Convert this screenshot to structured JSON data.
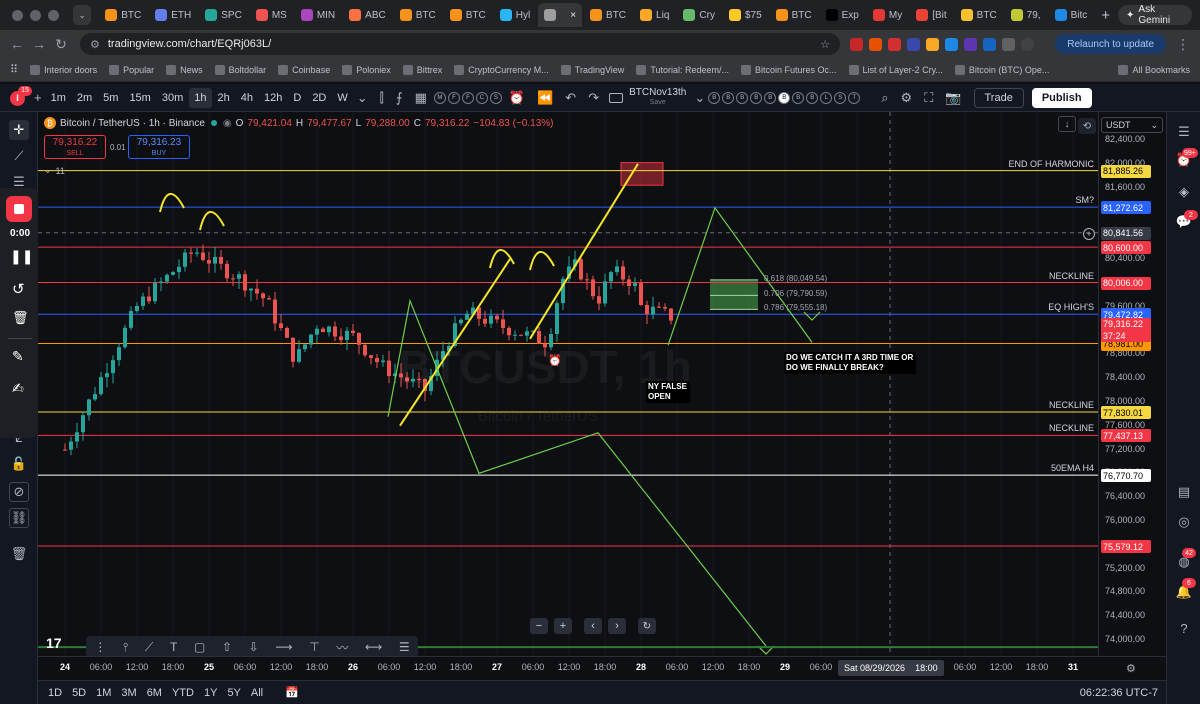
{
  "browser": {
    "tabs": [
      {
        "label": "BTC",
        "color": "#f7931a"
      },
      {
        "label": "ETH",
        "color": "#627eea"
      },
      {
        "label": "SPC",
        "color": "#26a69a"
      },
      {
        "label": "MS",
        "color": "#ef5350"
      },
      {
        "label": "MIN",
        "color": "#ab47bc"
      },
      {
        "label": "ABC",
        "color": "#ff7043"
      },
      {
        "label": "BTC",
        "color": "#f7931a"
      },
      {
        "label": "BTC",
        "color": "#f7931a"
      },
      {
        "label": "Hyl",
        "color": "#29b6f6"
      },
      {
        "label": "",
        "color": "#9e9e9e"
      },
      {
        "label": "BTC",
        "color": "#f7931a"
      },
      {
        "label": "Liq",
        "color": "#ffa726"
      },
      {
        "label": "Cry",
        "color": "#66bb6a"
      },
      {
        "label": "$75",
        "color": "#ffca28"
      },
      {
        "label": "BTC",
        "color": "#f7931a"
      },
      {
        "label": "Exp",
        "color": "#000000"
      },
      {
        "label": "My",
        "color": "#e53935"
      },
      {
        "label": "[Bit",
        "color": "#ea4335"
      },
      {
        "label": "BTC",
        "color": "#fbc02d"
      },
      {
        "label": "79,",
        "color": "#c0ca33"
      },
      {
        "label": "Bitc",
        "color": "#1e88e5"
      }
    ],
    "ask_gemini": "Ask Gemini",
    "url": "tradingview.com/chart/EQRj063L/",
    "relaunch": "Relaunch to update",
    "bookmarks": [
      "Interior doors",
      "Popular",
      "News",
      "Boltdollar",
      "Coinbase",
      "Poloniex",
      "Bittrex",
      "CryptoCurrency M...",
      "TradingView",
      "Tutorial: Redeem/...",
      "Bitcoin Futures Oc...",
      "List of Layer-2 Cry...",
      "Bitcoin (BTC) Ope..."
    ],
    "all_bookmarks": "All Bookmarks"
  },
  "toolbar": {
    "alert_count": "15",
    "timeframes": [
      "1m",
      "2m",
      "5m",
      "15m",
      "30m",
      "1h",
      "2h",
      "4h",
      "12h",
      "D",
      "2D",
      "W"
    ],
    "active_timeframe": "1h",
    "indicator_letters": [
      "M",
      "F",
      "F",
      "C",
      "S"
    ],
    "layout_name": "BTCNov13th",
    "layout_sub": "Save",
    "symbol_letters": [
      "B",
      "B",
      "B",
      "B",
      "B",
      "B",
      "B",
      "B",
      "L",
      "S",
      "T"
    ],
    "trade": "Trade",
    "publish": "Publish"
  },
  "legend": {
    "symbol": "Bitcoin / TetherUS · 1h · Binance",
    "o_label": "O",
    "o": "79,421.04",
    "h_label": "H",
    "h": "79,477.67",
    "l_label": "L",
    "l": "79,288.00",
    "c_label": "C",
    "c": "79,316.22",
    "change": "−104.83 (−0.13%)",
    "sell_price": "79,316.22",
    "sell": "SELL",
    "spread": "0.01",
    "buy_price": "79,316.23",
    "buy": "BUY",
    "indicator_count": "11"
  },
  "recorder": {
    "time": "0:00"
  },
  "price_scale": {
    "currency": "USDT",
    "ticks": [
      "82,400.00",
      "82,000.00",
      "81,600.00",
      "81,200.00",
      "80,800.00",
      "80,400.00",
      "80,000.00",
      "79,600.00",
      "79,200.00",
      "78,800.00",
      "78,400.00",
      "78,000.00",
      "77,600.00",
      "77,200.00",
      "76,800.00",
      "76,400.00",
      "76,000.00",
      "75,600.00",
      "75,200.00",
      "74,800.00",
      "74,400.00",
      "74,000.00"
    ]
  },
  "levels": [
    {
      "name": "END OF HARMONIC",
      "price": 81885.26,
      "label": "81,885.26",
      "color": "#f5d742",
      "text": "#000000"
    },
    {
      "name": "SM?",
      "price": 81272.62,
      "label": "81,272.62",
      "color": "#2962ff",
      "text": "#ffffff"
    },
    {
      "name": "",
      "price": 80600.0,
      "label": "80,600.00",
      "color": "#f23645",
      "text": "#ffffff"
    },
    {
      "name": "NECKLINE",
      "price": 80006.0,
      "label": "80,006.00",
      "color": "#f23645",
      "text": "#ffffff"
    },
    {
      "name": "EQ HIGH'S",
      "price": 79472.82,
      "label": "79,472.82",
      "color": "#2962ff",
      "text": "#ffffff"
    },
    {
      "name": "",
      "price": 78981.0,
      "label": "78,981.00",
      "color": "#ff9800",
      "text": "#000000"
    },
    {
      "name": "NECKLINE",
      "price": 77830.01,
      "label": "77,830.01",
      "color": "#f5d742",
      "text": "#000000"
    },
    {
      "name": "NECKLINE",
      "price": 77437.13,
      "label": "77,437.13",
      "color": "#f23645",
      "text": "#ffffff"
    },
    {
      "name": "50EMA H4",
      "price": 76770.7,
      "label": "76,770.70",
      "color": "#ffffff",
      "text": "#000000"
    },
    {
      "name": "",
      "price": 75579.12,
      "label": "75,579.12",
      "color": "#f23645",
      "text": "#ffffff"
    }
  ],
  "current_price": {
    "label": "79,316.22",
    "countdown": "37:24",
    "color": "#f23645"
  },
  "crosshair_price": "80,841.56",
  "fib": [
    {
      "label": "0.618 (80,049.54)",
      "price": 80049.54
    },
    {
      "label": "0.706 (79,790.59)",
      "price": 79790.59
    },
    {
      "label": "0.786 (79,555.18)",
      "price": 79555.18
    }
  ],
  "annotations": {
    "question": "DO WE CATCH IT A 3RD TIME OR DO WE FINALLY BREAK?",
    "ny": "NY FALSE OPEN",
    "watermark": "BTCUSDT, 1h",
    "watermark_sub": "Bitcoin / TetherUS"
  },
  "time_scale": {
    "labels": [
      "24",
      "06:00",
      "12:00",
      "18:00",
      "25",
      "06:00",
      "12:00",
      "18:00",
      "26",
      "06:00",
      "12:00",
      "18:00",
      "27",
      "06:00",
      "12:00",
      "18:00",
      "28",
      "06:00",
      "12:00",
      "18:00",
      "29",
      "06:00",
      "12:00",
      "18:00",
      "06:00",
      "12:00",
      "18:00",
      "31"
    ],
    "crosshair": "Sat 08/29/2026",
    "crosshair_time": "18:00"
  },
  "bottom": {
    "ranges": [
      "1D",
      "5D",
      "1M",
      "3M",
      "6M",
      "YTD",
      "1Y",
      "5Y",
      "All"
    ],
    "clock": "06:22:36 UTC-7"
  },
  "colors": {
    "up": "#26a69a",
    "down": "#ef5350",
    "accent": "#2962ff",
    "drawing": "#f5e727",
    "wave": "#6fcf4a"
  }
}
